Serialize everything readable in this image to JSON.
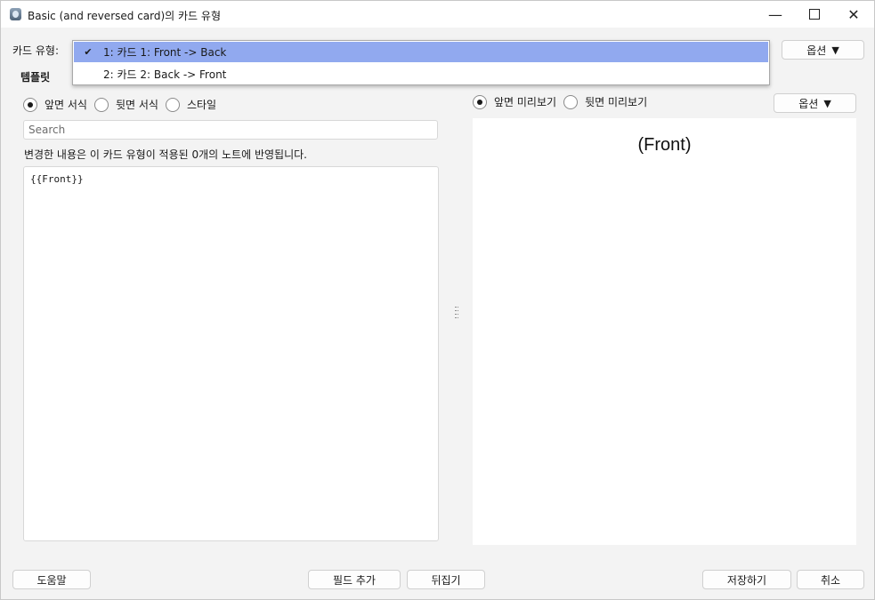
{
  "window": {
    "title": "Basic (and reversed card)의 카드 유형",
    "controls": {
      "minimize": "—",
      "maximize": "",
      "close": "✕"
    }
  },
  "card_type": {
    "label": "카드 유형:",
    "options": [
      {
        "label": "1: 카드 1: Front -> Back",
        "selected": true,
        "check": "✔"
      },
      {
        "label": "2: 카드 2: Back -> Front",
        "selected": false,
        "check": ""
      }
    ],
    "options_button": {
      "label": "옵션",
      "caret": "▼"
    }
  },
  "template": {
    "heading": "템플릿",
    "radios": [
      {
        "label": "앞면 서식",
        "checked": true
      },
      {
        "label": "뒷면 서식",
        "checked": false
      },
      {
        "label": "스타일",
        "checked": false
      }
    ],
    "search_placeholder": "Search",
    "notice": "변경한 내용은 이 카드 유형이 적용된 0개의 노트에 반영됩니다.",
    "editor_content": "{{Front}}"
  },
  "preview": {
    "radios": [
      {
        "label": "앞면 미리보기",
        "checked": true
      },
      {
        "label": "뒷면 미리보기",
        "checked": false
      }
    ],
    "options_button": {
      "label": "옵션",
      "caret": "▼"
    },
    "rendered_text": "(Front)"
  },
  "footer": {
    "help": "도움말",
    "add_field": "필드 추가",
    "flip": "뒤집기",
    "save": "저장하기",
    "cancel": "취소"
  },
  "colors": {
    "selection": "#91a9ef",
    "window_bg": "#f3f3f3",
    "panel_bg": "#ffffff"
  }
}
